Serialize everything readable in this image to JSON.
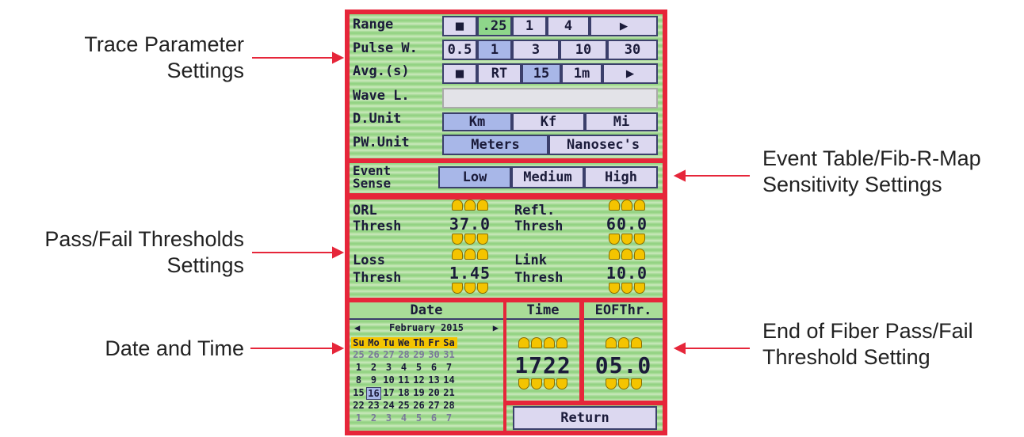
{
  "annotations": {
    "trace_params": [
      "Trace Parameter",
      "Settings"
    ],
    "event_sens": [
      "Event Table/Fib-R-Map",
      "Sensitivity Settings"
    ],
    "passfail": [
      "Pass/Fail Thresholds",
      "Settings"
    ],
    "datetime": "Date and Time",
    "eof": [
      "End of Fiber Pass/Fail",
      "Threshold Setting"
    ]
  },
  "trace": {
    "range_label": "Range",
    "range_options": [
      "■",
      ".25",
      "1",
      "4",
      "▶"
    ],
    "pulse_label": "Pulse W.",
    "pulse_options": [
      "0.5",
      "1",
      "3",
      "10",
      "30"
    ],
    "avg_label": "Avg.(s)",
    "avg_options": [
      "■",
      "RT",
      "15",
      "1m",
      "▶"
    ],
    "wave_label": "Wave L.",
    "dunit_label": "D.Unit",
    "dunit_options": [
      "Km",
      "Kf",
      "Mi"
    ],
    "pwunit_label": "PW.Unit",
    "pwunit_options": [
      "Meters",
      "Nanosec's"
    ]
  },
  "event": {
    "label_line1": "Event",
    "label_line2": "Sense",
    "options": [
      "Low",
      "Medium",
      "High"
    ]
  },
  "thresholds": {
    "orl_label1": "ORL",
    "orl_label2": "Thresh",
    "orl_value": "37.0",
    "refl_label1": "Refl.",
    "refl_label2": "Thresh",
    "refl_value": "60.0",
    "loss_label1": "Loss",
    "loss_label2": "Thresh",
    "loss_value": "1.45",
    "link_label1": "Link",
    "link_label2": "Thresh",
    "link_value": "10.0"
  },
  "date": {
    "header": "Date",
    "month": "February 2015",
    "weekdays": [
      "Su",
      "Mo",
      "Tu",
      "We",
      "Th",
      "Fr",
      "Sa"
    ],
    "rows": [
      [
        "25",
        "26",
        "27",
        "28",
        "29",
        "30",
        "31"
      ],
      [
        "1",
        "2",
        "3",
        "4",
        "5",
        "6",
        "7"
      ],
      [
        "8",
        "9",
        "10",
        "11",
        "12",
        "13",
        "14"
      ],
      [
        "15",
        "16",
        "17",
        "18",
        "19",
        "20",
        "21"
      ],
      [
        "22",
        "23",
        "24",
        "25",
        "26",
        "27",
        "28"
      ],
      [
        "1",
        "2",
        "3",
        "4",
        "5",
        "6",
        "7"
      ]
    ],
    "selected_day": "16"
  },
  "time": {
    "header": "Time",
    "value": "1722"
  },
  "eof": {
    "header": "EOFThr.",
    "value": "05.0"
  },
  "return_label": "Return",
  "colors": {
    "frame": "#e6263a",
    "button": "#dcd8f0",
    "selected": "#a8b7e8",
    "arrows": "#f4c400"
  }
}
